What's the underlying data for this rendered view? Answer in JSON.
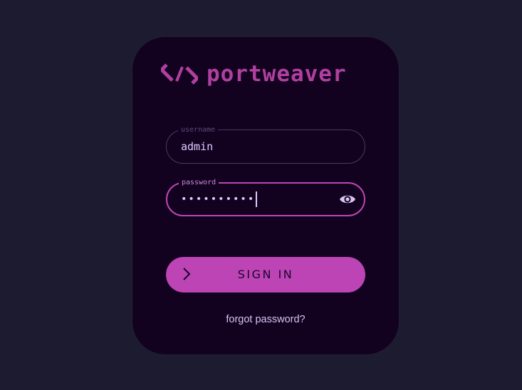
{
  "brand": {
    "name": "portweaver",
    "logo_icon": "portweaver-logo-icon",
    "color": "#b03fa0"
  },
  "login": {
    "username": {
      "label": "username",
      "value": "admin"
    },
    "password": {
      "label": "password",
      "value": "••••••••••",
      "toggle_icon": "eye-icon"
    },
    "submit": {
      "label": "SIGN IN",
      "icon": "chevron-right-icon"
    },
    "forgot_label": "forgot password?"
  },
  "colors": {
    "background": "#1d1b30",
    "card": "#12021f",
    "accent": "#bc44b5",
    "text_light": "#e0c8ff"
  }
}
